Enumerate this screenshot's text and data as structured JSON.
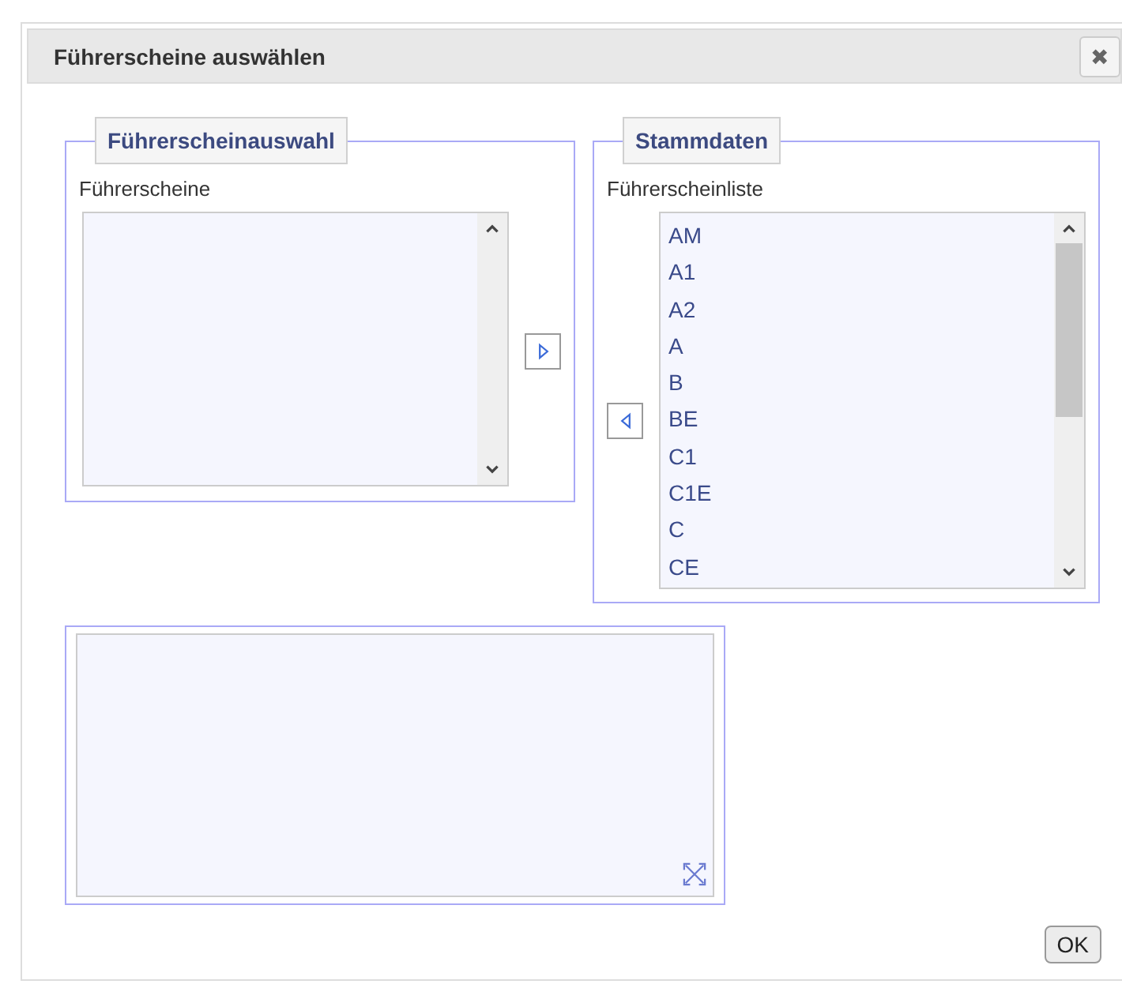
{
  "dialog": {
    "title": "Führerscheine auswählen",
    "close_icon": "✖"
  },
  "selection": {
    "legend": "Führerscheinauswahl",
    "label": "Führerscheine"
  },
  "master": {
    "legend": "Stammdaten",
    "label": "Führerscheinliste",
    "items": [
      {
        "label": "AM",
        "selected": false
      },
      {
        "label": "A1",
        "selected": false
      },
      {
        "label": "A2",
        "selected": false
      },
      {
        "label": "A",
        "selected": false
      },
      {
        "label": "B",
        "selected": false
      },
      {
        "label": "BE",
        "selected": false
      },
      {
        "label": "C1",
        "selected": false
      },
      {
        "label": "C1E",
        "selected": false
      },
      {
        "label": "C",
        "selected": false
      },
      {
        "label": "CE",
        "selected": false
      }
    ]
  },
  "buttons": [
    {
      "label": "OK"
    }
  ]
}
